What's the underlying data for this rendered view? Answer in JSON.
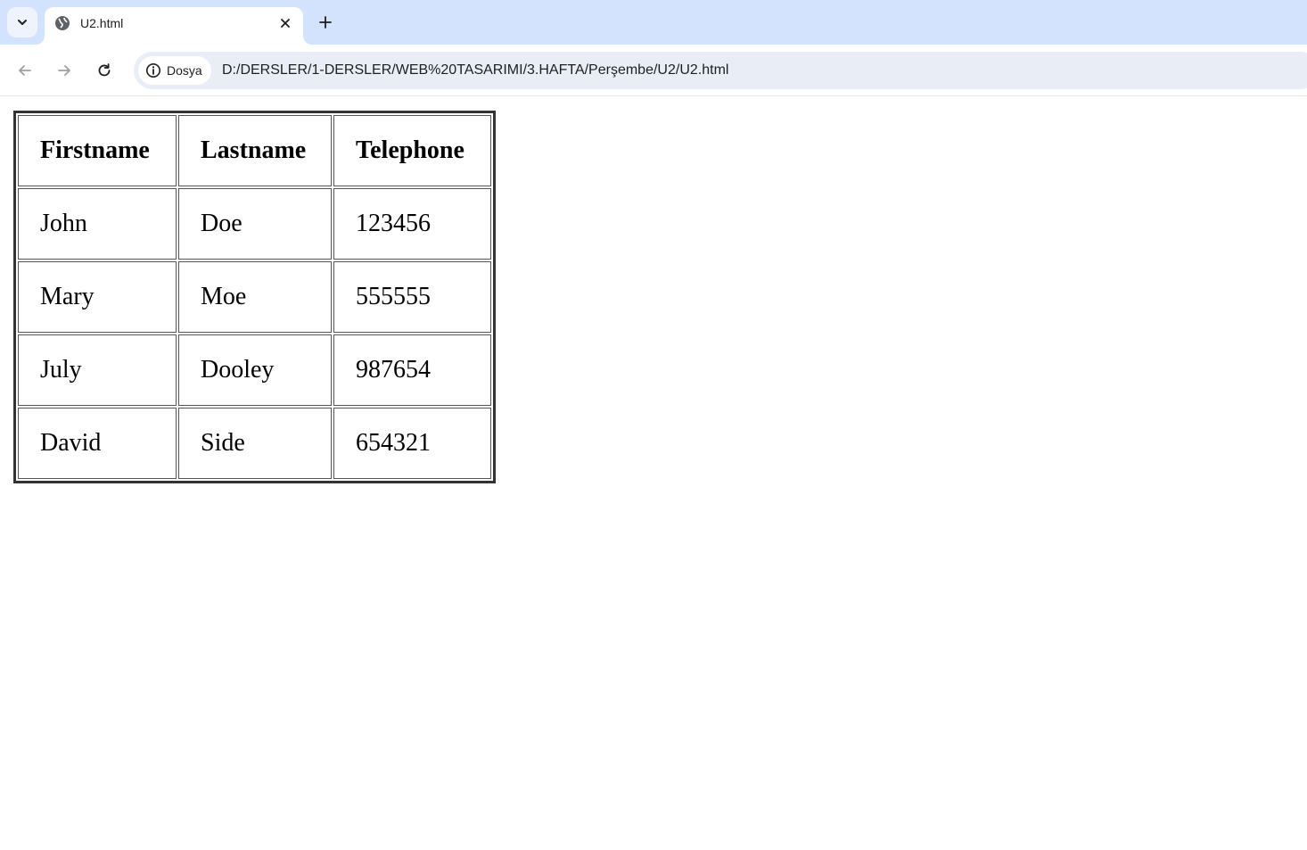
{
  "browser": {
    "tab": {
      "title": "U2.html",
      "favicon": "globe-icon"
    },
    "tab_search_icon": "chevron-down-icon",
    "new_tab_icon": "plus-icon",
    "nav": {
      "back_icon": "arrow-left-icon",
      "forward_icon": "arrow-right-icon",
      "reload_icon": "reload-icon"
    },
    "omnibox": {
      "chip_icon": "info-icon",
      "chip_label": "Dosya",
      "url": "D:/DERSLER/1-DERSLER/WEB%20TASARIMI/3.HAFTA/Perşembe/U2/U2.html"
    },
    "colors": {
      "tabstrip": "#d3e3fd",
      "omnibox": "#e9eef6"
    }
  },
  "table": {
    "headers": [
      "Firstname",
      "Lastname",
      "Telephone"
    ],
    "rows": [
      [
        "John",
        "Doe",
        "123456"
      ],
      [
        "Mary",
        "Moe",
        "555555"
      ],
      [
        "July",
        "Dooley",
        "987654"
      ],
      [
        "David",
        "Side",
        "654321"
      ]
    ]
  }
}
